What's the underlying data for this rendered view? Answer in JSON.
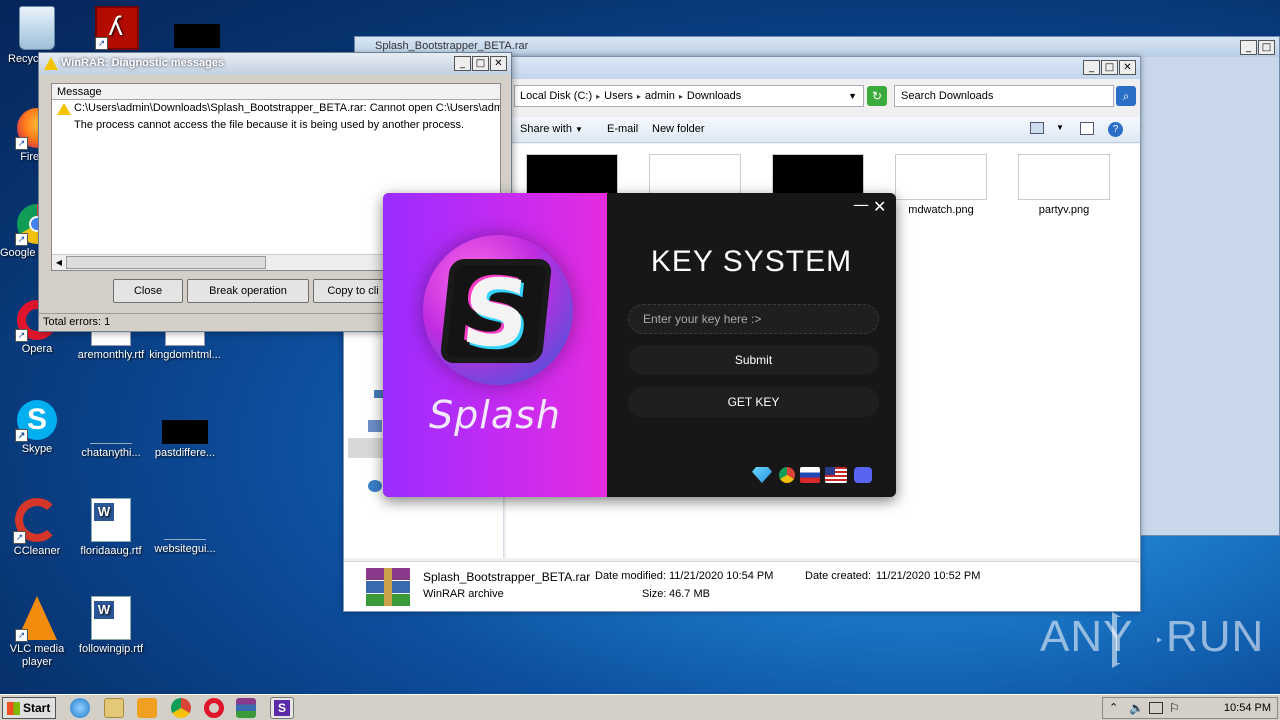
{
  "desktop_icons": [
    {
      "label": "Recycle Bin",
      "shortcut": false
    },
    {
      "label": "",
      "shortcut": true
    },
    {
      "label": "",
      "shortcut": false
    },
    {
      "label": "Firefox",
      "shortcut": true
    },
    {
      "label": "Google Chrome",
      "shortcut": true
    },
    {
      "label": "Opera",
      "shortcut": true
    },
    {
      "label": "aremonthly.rtf",
      "shortcut": false
    },
    {
      "label": "kingdomhtml...",
      "shortcut": false
    },
    {
      "label": "Skype",
      "shortcut": true
    },
    {
      "label": "chatanythi...",
      "shortcut": false
    },
    {
      "label": "pastdiffere...",
      "shortcut": false
    },
    {
      "label": "CCleaner",
      "shortcut": true
    },
    {
      "label": "floridaaug.rtf",
      "shortcut": false
    },
    {
      "label": "websitegui...",
      "shortcut": false
    },
    {
      "label": "VLC media player",
      "shortcut": true
    },
    {
      "label": "followingip.rtf",
      "shortcut": false
    }
  ],
  "explorer_back": {
    "title": "Splash_Bootstrapper_BETA.rar"
  },
  "explorer": {
    "breadcrumb": [
      "Local Disk (C:)",
      "Users",
      "admin",
      "Downloads"
    ],
    "search_placeholder": "Search Downloads",
    "commands": {
      "share": "Share with",
      "email": "E-mail",
      "new_folder": "New folder"
    },
    "files": [
      {
        "name": "",
        "thumb": "#000000"
      },
      {
        "name": "",
        "thumb": "#ffffff"
      },
      {
        "name": "",
        "thumb": "#000000"
      },
      {
        "name": "mdwatch.png",
        "thumb": "#ffffff"
      },
      {
        "name": "partyv.png",
        "thumb": "#ffffff"
      }
    ],
    "details": {
      "name": "Splash_Bootstrapper_BETA.rar",
      "type": "WinRAR archive",
      "modified_label": "Date modified:",
      "modified": "11/21/2020 10:54 PM",
      "created_label": "Date created:",
      "created": "11/21/2020 10:52 PM",
      "size_label": "Size:",
      "size": "46.7 MB"
    }
  },
  "winrar": {
    "title": "WinRAR: Diagnostic messages",
    "column": "Message",
    "messages": [
      "C:\\Users\\admin\\Downloads\\Splash_Bootstrapper_BETA.rar: Cannot open C:\\Users\\admin",
      "The process cannot access the file because it is being used by another process."
    ],
    "buttons": {
      "close": "Close",
      "break": "Break operation",
      "copy": "Copy to cli"
    },
    "status": "Total errors: 1"
  },
  "splash": {
    "brand": "Splash",
    "title": "KEY SYSTEM",
    "input_placeholder": "Enter your key here :>",
    "submit": "Submit",
    "get_key": "GET KEY",
    "minimize": "—",
    "close": "✕",
    "accent_gradient": [
      "#9b2cff",
      "#e42cdf"
    ]
  },
  "taskbar": {
    "start": "Start",
    "clock": "10:54 PM"
  },
  "watermark": {
    "text_left": "ANY",
    "text_right": "RUN"
  }
}
